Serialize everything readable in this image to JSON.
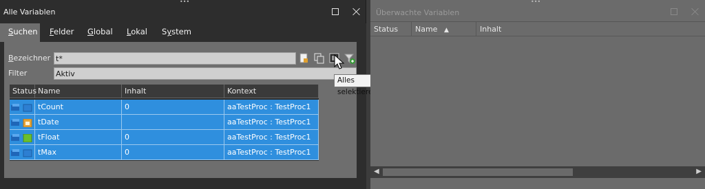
{
  "left_panel": {
    "title": "Alle Variablen",
    "tabs": [
      {
        "label_u": "S",
        "label_rest": "uchen"
      },
      {
        "label_u": "F",
        "label_rest": "elder"
      },
      {
        "label_u": "G",
        "label_rest": "lobal"
      },
      {
        "label_u": "L",
        "label_rest": "okal"
      },
      {
        "label_pre": "S",
        "label_u": "y",
        "label_rest": "stem"
      }
    ],
    "bezeichner_u": "B",
    "bezeichner_rest": "ezeichner",
    "bezeichner_value": "t*",
    "filter_label": "Filter",
    "filter_value": "Aktiv",
    "tooltip": "Alles selektieren",
    "table": {
      "columns": [
        "Status",
        "Name",
        "Inhalt",
        "Kontext"
      ],
      "rows": [
        {
          "name": "tCount",
          "inhalt": "0",
          "kontext": "aaTestProc : TestProc1",
          "icon": "int-icon",
          "icon_color": "#2d7fd2"
        },
        {
          "name": "tDate",
          "inhalt": "",
          "kontext": "aaTestProc : TestProc1",
          "icon": "date-icon",
          "icon_color": "#e8a436"
        },
        {
          "name": "tFloat",
          "inhalt": "0",
          "kontext": "aaTestProc : TestProc1",
          "icon": "float-icon",
          "icon_color": "#6bbf2e"
        },
        {
          "name": "tMax",
          "inhalt": "0",
          "kontext": "aaTestProc : TestProc1",
          "icon": "int-icon",
          "icon_color": "#2d7fd2"
        }
      ]
    }
  },
  "right_panel": {
    "title": "Überwachte Variablen",
    "columns": [
      "Status",
      "Name",
      "Inhalt"
    ],
    "sort_indicator": "▲"
  },
  "colors": {
    "selection": "#2f8fde",
    "panel_bg": "#6e6e6e",
    "dark_bg": "#2d2d2d"
  }
}
